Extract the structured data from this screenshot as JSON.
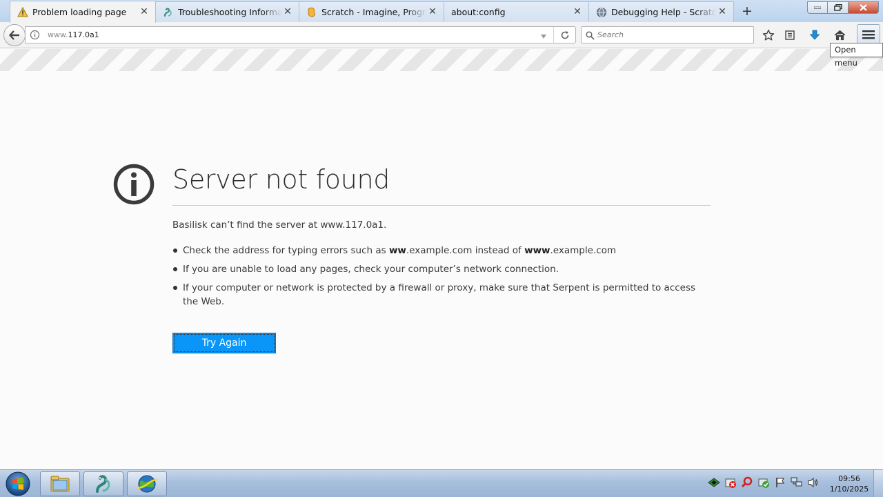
{
  "browser": {
    "tabs": [
      {
        "title": "Problem loading page",
        "icon": "warning-icon",
        "active": true
      },
      {
        "title": "Troubleshooting Information",
        "icon": "serpent-icon",
        "active": false
      },
      {
        "title": "Scratch - Imagine, Program, Share",
        "icon": "scratch-icon",
        "active": false
      },
      {
        "title": "about:config",
        "icon": "none",
        "active": false
      },
      {
        "title": "Debugging Help - Scratch Wiki",
        "icon": "globe-icon",
        "active": false
      }
    ],
    "new_tab_label": "+",
    "url": {
      "prefix": "www.",
      "host": "117.0a1"
    },
    "search_placeholder": "Search",
    "menu_tooltip": "Open menu"
  },
  "error_page": {
    "title": "Server not found",
    "description": "Basilisk can’t find the server at www.117.0a1.",
    "suggestions": [
      {
        "pre": "Check the address for typing errors such as ",
        "b1": "ww",
        "mid1": ".example.com instead of ",
        "b2": "www",
        "post": ".example.com"
      },
      {
        "text": "If you are unable to load any pages, check your computer’s network connection."
      },
      {
        "text": "If your computer or network is protected by a firewall or proxy, make sure that Serpent is permitted to access the Web."
      }
    ],
    "try_again_label": "Try Again",
    "accent_color": "#0996f8"
  },
  "taskbar": {
    "items": [
      "explorer-icon",
      "serpent-icon",
      "network-globe-icon"
    ],
    "tray_icons": [
      "app-tray-icon",
      "error-tray-icon",
      "search-tray-icon",
      "update-tray-icon",
      "flag-icon",
      "network-icon",
      "volume-icon"
    ],
    "time": "09:56",
    "date": "1/10/2025"
  }
}
